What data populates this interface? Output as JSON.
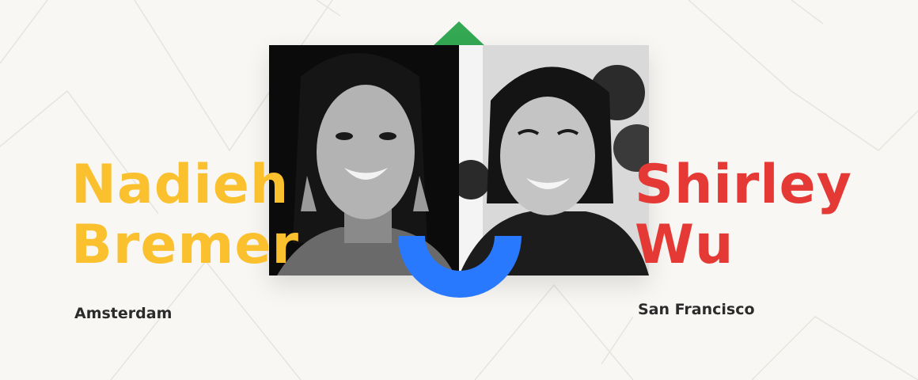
{
  "colors": {
    "background": "#f8f7f4",
    "line": "#e6e4de",
    "left_accent": "#fbc02d",
    "right_accent": "#e53935",
    "green_triangle": "#34a853",
    "blue_smile": "#2979ff",
    "city_text": "#2b2b2b"
  },
  "speakers": [
    {
      "first_name": "Nadieh",
      "last_name": "Bremer",
      "city": "Amsterdam",
      "photo_style": "black-and-white portrait"
    },
    {
      "first_name": "Shirley",
      "last_name": "Wu",
      "city": "San Francisco",
      "photo_style": "black-and-white portrait"
    }
  ],
  "decorations": {
    "top_shape": "triangle-icon",
    "bottom_shape": "semicircle-smile-icon"
  }
}
